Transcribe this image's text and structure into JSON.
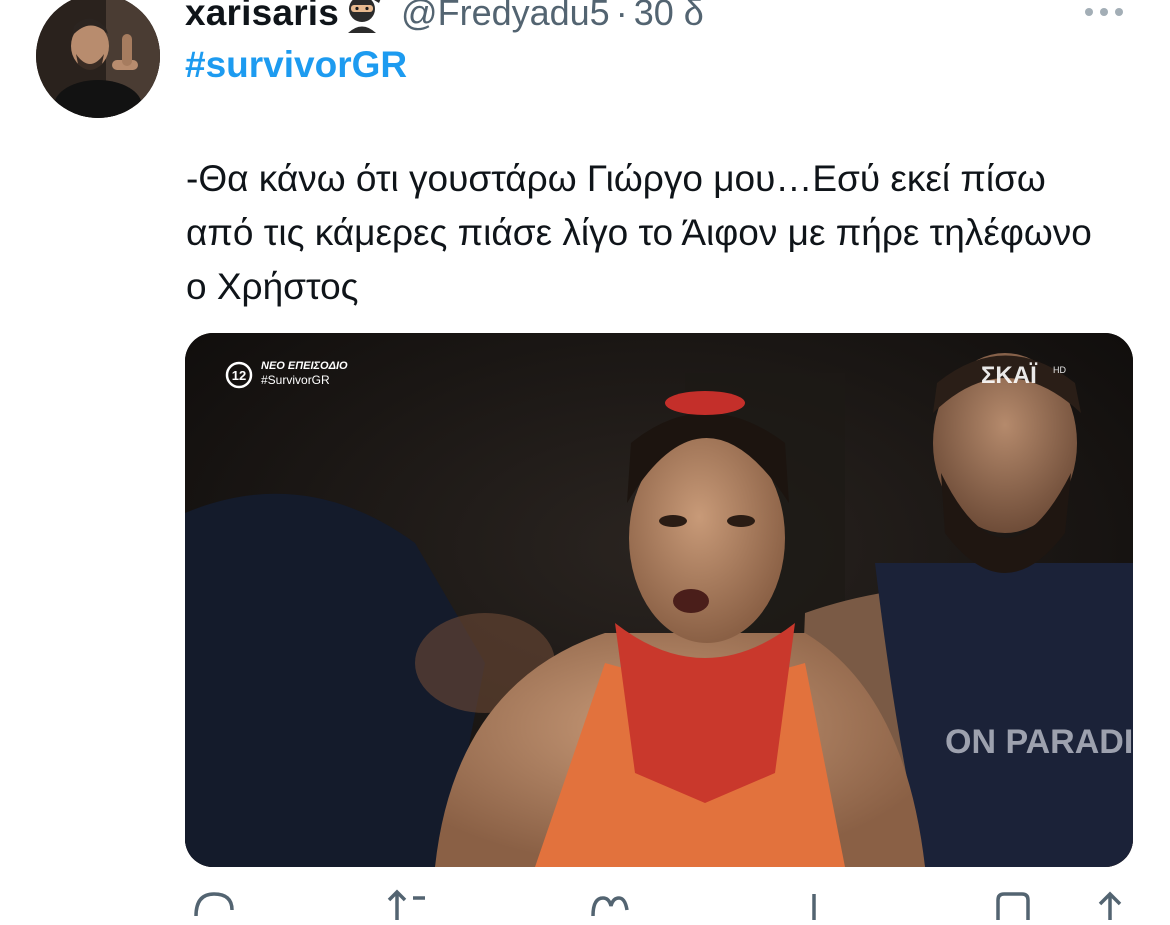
{
  "tweet": {
    "display_name": "xarisaris",
    "handle": "@Fredyadu5",
    "separator": "·",
    "timestamp": "30 δ",
    "hashtag": "#survivorGR",
    "text": "-Θα κάνω ότι γουστάρω Γιώργο μου…Εσύ εκεί πίσω από τις κάμερες πιάσε λίγο το Άιφον με πήρε τηλέφωνο ο Χρήστος"
  },
  "media_overlay": {
    "episode_label": "ΝΕΟ ΕΠΕΙΣΟΔΙΟ",
    "episode_hashtag": "#SurvivorGR",
    "rating_badge": "12",
    "channel_logo": "ΣΚΑΪ",
    "channel_hd": "HD",
    "shirt_text": "ON PARADIS"
  },
  "icons": {
    "avatar": "avatar-photo",
    "emoji": "ninja-emoji",
    "more": "more-horizontal-icon",
    "reply": "reply-icon",
    "retweet": "retweet-icon",
    "like": "heart-icon",
    "views": "views-icon",
    "bookmark": "bookmark-icon",
    "share": "share-icon"
  },
  "colors": {
    "text": "#0f1419",
    "secondary": "#536471",
    "link": "#1d9bf0"
  }
}
